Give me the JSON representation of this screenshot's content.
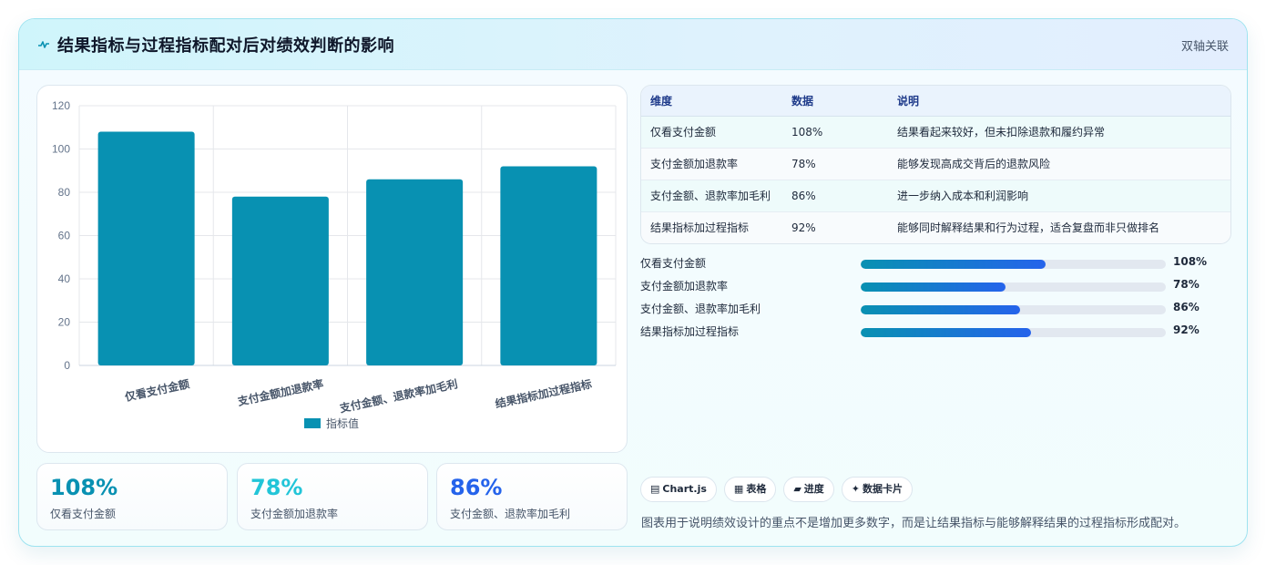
{
  "header": {
    "title": "结果指标与过程指标配对后对绩效判断的影响",
    "badge": "双轴关联"
  },
  "chart_data": {
    "type": "bar",
    "categories": [
      "仅看支付金额",
      "支付金额加退款率",
      "支付金额、退款率加毛利",
      "结果指标加过程指标"
    ],
    "series": [
      {
        "name": "指标值",
        "values": [
          108,
          78,
          86,
          92
        ]
      }
    ],
    "ylim": [
      0,
      120
    ],
    "yticks": [
      0,
      20,
      40,
      60,
      80,
      100,
      120
    ],
    "grid": true,
    "legend": "bottom",
    "color": "#0891b2"
  },
  "stats": [
    {
      "value": "108%",
      "label": "仅看支付金额",
      "color": "#0891b2"
    },
    {
      "value": "78%",
      "label": "支付金额加退款率",
      "color": "#22c5d8"
    },
    {
      "value": "86%",
      "label": "支付金额、退款率加毛利",
      "color": "#2563eb"
    }
  ],
  "table": {
    "headers": [
      "维度",
      "数据",
      "说明"
    ],
    "rows": [
      {
        "dimension": "仅看支付金额",
        "data": "108%",
        "note": "结果看起来较好，但未扣除退款和履约异常"
      },
      {
        "dimension": "支付金额加退款率",
        "data": "78%",
        "note": "能够发现高成交背后的退款风险"
      },
      {
        "dimension": "支付金额、退款率加毛利",
        "data": "86%",
        "note": "进一步纳入成本和利润影响"
      },
      {
        "dimension": "结果指标加过程指标",
        "data": "92%",
        "note": "能够同时解释结果和行为过程，适合复盘而非只做排名"
      }
    ]
  },
  "progress": [
    {
      "label": "仅看支付金额",
      "value": "108%",
      "fraction": 0.607
    },
    {
      "label": "支付金额加退款率",
      "value": "78%",
      "fraction": 0.474
    },
    {
      "label": "支付金额、退款率加毛利",
      "value": "86%",
      "fraction": 0.523
    },
    {
      "label": "结果指标加过程指标",
      "value": "92%",
      "fraction": 0.558
    }
  ],
  "chips": [
    {
      "icon": "▤",
      "icon_name": "chart-icon",
      "label": "Chart.js"
    },
    {
      "icon": "▦",
      "icon_name": "table-icon",
      "label": "表格"
    },
    {
      "icon": "▰",
      "icon_name": "progress-icon",
      "label": "进度"
    },
    {
      "icon": "✦",
      "icon_name": "sparkle-icon",
      "label": "数据卡片"
    }
  ],
  "caption": "图表用于说明绩效设计的重点不是增加更多数字，而是让结果指标与能够解释结果的过程指标形成配对。"
}
